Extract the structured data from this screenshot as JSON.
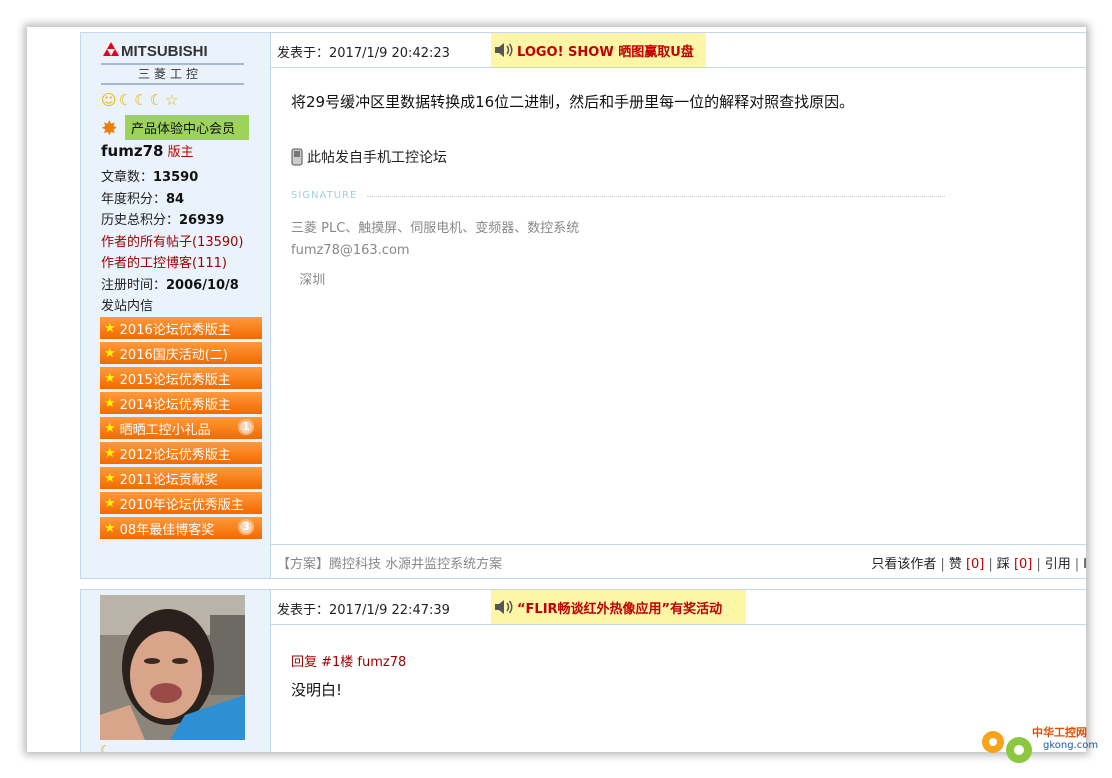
{
  "colors": {
    "accent_red": "#c00000",
    "post_border": "#c5d7ea",
    "sidebar_bg": "#eaf2fb",
    "medal_orange": "#f26a00",
    "ad_bg": "#fdf6a6"
  },
  "post1": {
    "user": {
      "logo_text": "MITSUBISHI",
      "logo_sub": "三菱工控",
      "level_icons": [
        "smiley-icon",
        "moon-icon",
        "moon-icon",
        "moon-icon",
        "star-icon"
      ],
      "member_label": "产品体验中心会员",
      "name": "fumz78",
      "role": "版主",
      "posts_label": "文章数：",
      "posts": "13590",
      "year_points_label": "年度积分：",
      "year_points": "84",
      "total_points_label": "历史总积分：",
      "total_points": "26939",
      "all_posts_link": "作者的所有帖子(13590)",
      "blog_link": "作者的工控博客(111)",
      "reg_label": "注册时间：",
      "reg_date": "2006/10/8",
      "pm_link": "发站内信",
      "medals": [
        {
          "label": "2016论坛优秀版主",
          "count": ""
        },
        {
          "label": "2016国庆活动(二)",
          "count": ""
        },
        {
          "label": "2015论坛优秀版主",
          "count": ""
        },
        {
          "label": "2014论坛优秀版主",
          "count": ""
        },
        {
          "label": "晒晒工控小礼品",
          "count": "1"
        },
        {
          "label": "2012论坛优秀版主",
          "count": ""
        },
        {
          "label": "2011论坛贡献奖",
          "count": ""
        },
        {
          "label": "2010年论坛优秀版主",
          "count": ""
        },
        {
          "label": "08年最佳博客奖",
          "count": "3"
        }
      ]
    },
    "time": "发表于：2017/1/9 20:42:23",
    "ad_link": "LOGO! SHOW 晒图赢取U盘",
    "body": "将29号缓冲区里数据转换成16位二进制，然后和手册里每一位的解释对照查找原因。",
    "mobile_note": "此帖发自手机工控论坛",
    "signature_label": "SIGNATURE",
    "signature_lines": [
      "三菱 PLC、触摸屏、伺服电机、变频器、数控系统",
      "fumz78@163.com",
      "  深圳"
    ],
    "footer_ad_prefix": "【方案】",
    "footer_ad_link": "腾控科技 水源井监控系统方案",
    "footer": {
      "only_author": "只看该作者",
      "like_label": "赞",
      "like_count": "[0]",
      "dislike_label": "踩",
      "dislike_count": "[0]",
      "quote": "引用",
      "more": "Ⅰ"
    }
  },
  "post2": {
    "time": "发表于：2017/1/9 22:47:39",
    "ad_link": "“FLIR畅谈红外热像应用”有奖活动",
    "reply_ref": "回复 #1楼 fumz78",
    "body": "没明白!"
  },
  "watermark": {
    "name": "中华工控网",
    "domain": "gkong.com"
  }
}
